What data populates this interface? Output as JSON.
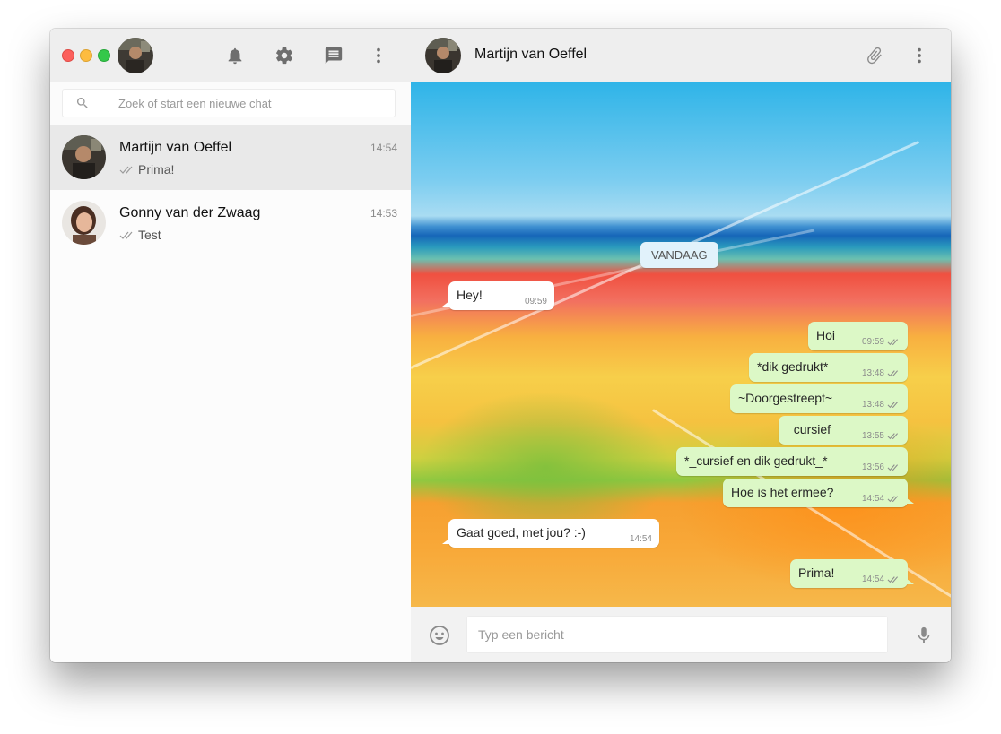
{
  "window": {
    "traffic_lights": [
      "close",
      "minimize",
      "zoom"
    ]
  },
  "sidebar": {
    "header_icons": [
      "bell-icon",
      "gear-icon",
      "new-chat-icon",
      "more-vert-icon"
    ],
    "search": {
      "placeholder": "Zoek of start een nieuwe chat",
      "value": ""
    },
    "chats": [
      {
        "name": "Martijn van Oeffel",
        "time": "14:54",
        "preview": "Prima!",
        "active": true
      },
      {
        "name": "Gonny van der Zwaag",
        "time": "14:53",
        "preview": "Test",
        "active": false
      }
    ]
  },
  "conversation": {
    "contact_name": "Martijn van Oeffel",
    "header_icons": [
      "paperclip-icon",
      "more-vert-icon"
    ],
    "date_chip": "VANDAAG",
    "messages": [
      {
        "dir": "in",
        "text": "Hey!",
        "time": "09:59"
      },
      {
        "dir": "out",
        "text": "Hoi",
        "time": "09:59"
      },
      {
        "dir": "out",
        "text": "*dik gedrukt*",
        "time": "13:48"
      },
      {
        "dir": "out",
        "text": "~Doorgestreept~",
        "time": "13:48"
      },
      {
        "dir": "out",
        "text": "_cursief_",
        "time": "13:55"
      },
      {
        "dir": "out",
        "text": "*_cursief en dik gedrukt_*",
        "time": "13:56"
      },
      {
        "dir": "out",
        "text": "Hoe is het ermee?",
        "time": "14:54"
      },
      {
        "dir": "in",
        "text": "Gaat goed, met jou? :-)",
        "time": "14:54"
      },
      {
        "dir": "out",
        "text": "Prima!",
        "time": "14:54"
      }
    ]
  },
  "composer": {
    "placeholder": "Typ een bericht",
    "value": ""
  },
  "colors": {
    "header_bg": "#eeeeee",
    "incoming_bubble": "#ffffff",
    "outgoing_bubble": "#dcf8c6",
    "date_chip_bg": "#e1f2fb",
    "active_chat_bg": "#e9e9e9"
  }
}
